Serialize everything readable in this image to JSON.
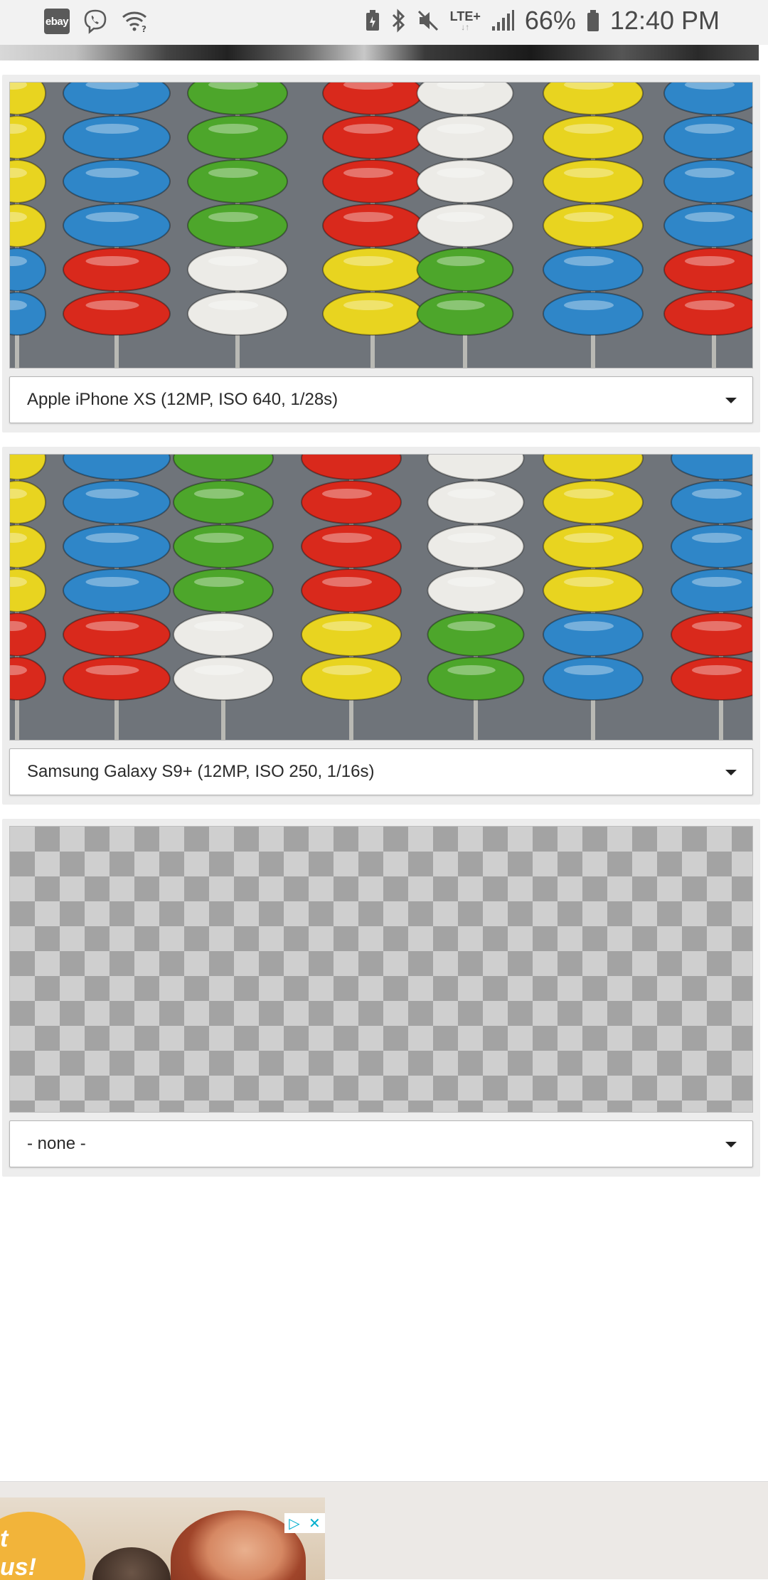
{
  "status_bar": {
    "left_icons": [
      "ebay-icon",
      "viber-icon",
      "wifi-icon"
    ],
    "ebay_label": "ebay",
    "network_label": "LTE+",
    "battery_percent": "66%",
    "time": "12:40 PM"
  },
  "cards": [
    {
      "camera": "Apple iPhone XS (12MP, ISO 640, 1/28s)"
    },
    {
      "camera": "Samsung Galaxy S9+ (12MP, ISO 250, 1/16s)"
    },
    {
      "camera": "- none -"
    }
  ],
  "ad": {
    "text": "t\nus!",
    "badge_icons": [
      "adchoices-icon",
      "close-icon"
    ]
  },
  "colors": {
    "bead_red": "#d9291c",
    "bead_blue": "#2f86c8",
    "bead_green": "#4da62b",
    "bead_yellow": "#e8d420",
    "bead_white": "#ecebe7",
    "card_bg": "#ededed"
  }
}
